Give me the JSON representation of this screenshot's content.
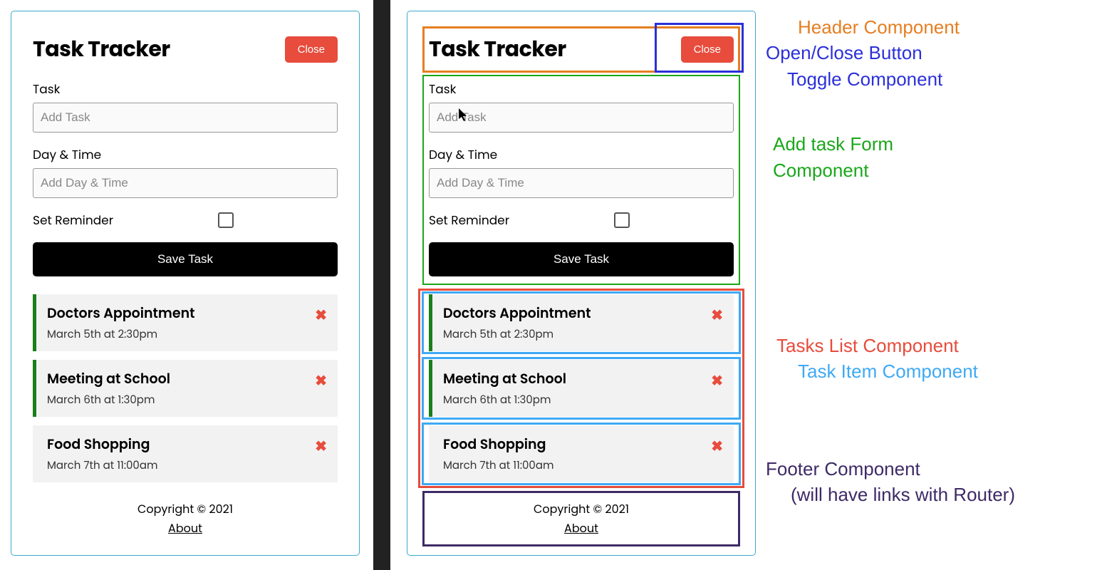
{
  "header": {
    "title": "Task Tracker",
    "close_label": "Close"
  },
  "form": {
    "task_label": "Task",
    "task_placeholder": "Add Task",
    "day_label": "Day & Time",
    "day_placeholder": "Add Day & Time",
    "reminder_label": "Set Reminder",
    "save_label": "Save Task"
  },
  "tasks": [
    {
      "title": "Doctors Appointment",
      "time": "March 5th at 2:30pm",
      "reminder": true
    },
    {
      "title": "Meeting at School",
      "time": "March 6th at 1:30pm",
      "reminder": true
    },
    {
      "title": "Food Shopping",
      "time": "March 7th at 11:00am",
      "reminder": false
    }
  ],
  "footer": {
    "copyright": "Copyright © 2021",
    "about_label": "About"
  },
  "legend": {
    "header": "Header Component",
    "toggle1": "Open/Close Button",
    "toggle2": "Toggle Component",
    "form1": "Add task Form",
    "form2": "Component",
    "tasks": "Tasks List Component",
    "taskitem": "Task Item Component",
    "footer1": "Footer Component",
    "footer2": "(will have links with Router)"
  }
}
